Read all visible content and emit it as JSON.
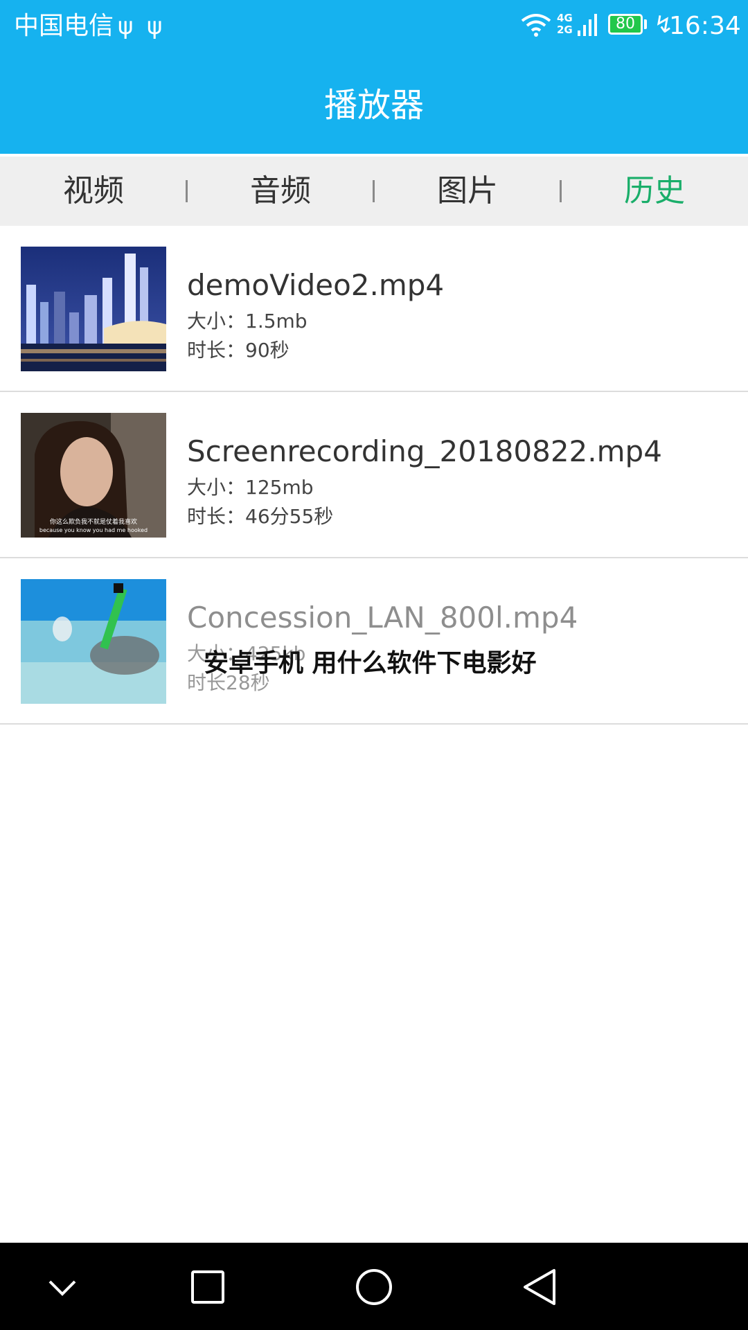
{
  "status_bar": {
    "carrier": "中国电信",
    "usb_icon": "usb-icon",
    "network_label_top": "4G",
    "network_label_bottom": "2G",
    "battery_level": "80",
    "time": "16:34"
  },
  "header": {
    "title": "播放器"
  },
  "tabs": [
    {
      "label": "视频",
      "active": false
    },
    {
      "label": "音频",
      "active": false
    },
    {
      "label": "图片",
      "active": false
    },
    {
      "label": "历史",
      "active": true
    }
  ],
  "history": [
    {
      "name": "demoVideo2.mp4",
      "size": "大小：1.5mb",
      "duration": "时长：90秒",
      "thumb": "city-night-skyline"
    },
    {
      "name": "Screenrecording_20180822.mp4",
      "size": "大小：125mb",
      "duration": "时长：46分55秒",
      "thumb": "woman-movie-frame",
      "thumb_caption_cn": "你这么欺负我不就是仗着我喜欢",
      "thumb_caption_en": "because you know you had me hooked"
    },
    {
      "name": "Concession_LAN_800l.mp4",
      "size": "大小：425kb",
      "duration": "时长28秒",
      "thumb": "snorkeler-underwater"
    }
  ],
  "overlay": {
    "text": "安卓手机 用什么软件下电影好"
  },
  "nav": {
    "back_icon": "back-triangle-icon",
    "home_icon": "home-circle-icon",
    "recents_icon": "recents-square-icon",
    "collapse_icon": "chevron-down-icon"
  },
  "colors": {
    "accent": "#16b2ef",
    "active_tab": "#1aae6a",
    "tab_bar_bg": "#efefef"
  }
}
